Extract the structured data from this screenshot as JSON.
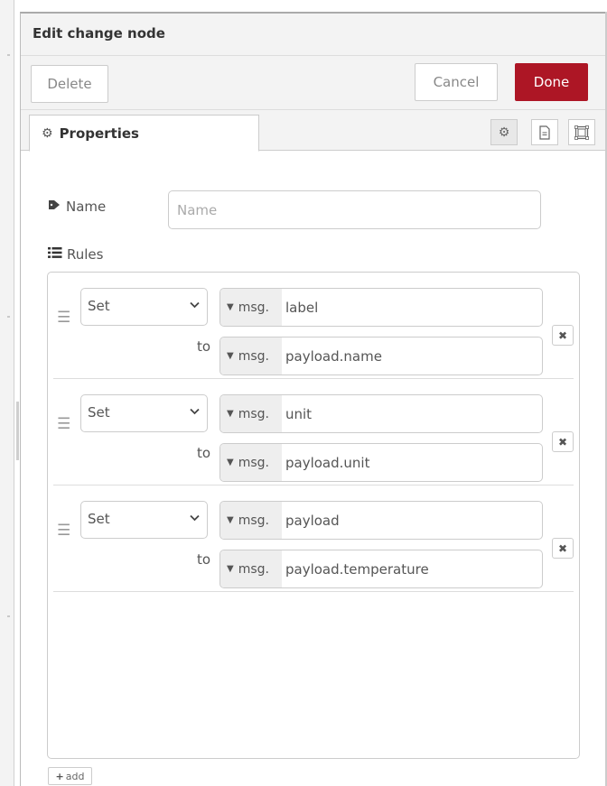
{
  "header": {
    "title": "Edit change node"
  },
  "toolbar": {
    "delete_label": "Delete",
    "cancel_label": "Cancel",
    "done_label": "Done",
    "done_color": "#ad1625"
  },
  "tabs": {
    "properties_label": "Properties"
  },
  "form": {
    "name_label": "Name",
    "name_placeholder": "Name",
    "name_value": "",
    "rules_label": "Rules",
    "to_label": "to",
    "add_label": "add"
  },
  "rules": [
    {
      "action": "Set",
      "target_type": "msg.",
      "target_value": "label",
      "source_type": "msg.",
      "source_value": "payload.name"
    },
    {
      "action": "Set",
      "target_type": "msg.",
      "target_value": "unit",
      "source_type": "msg.",
      "source_value": "payload.unit"
    },
    {
      "action": "Set",
      "target_type": "msg.",
      "target_value": "payload",
      "source_type": "msg.",
      "source_value": "payload.temperature"
    }
  ]
}
